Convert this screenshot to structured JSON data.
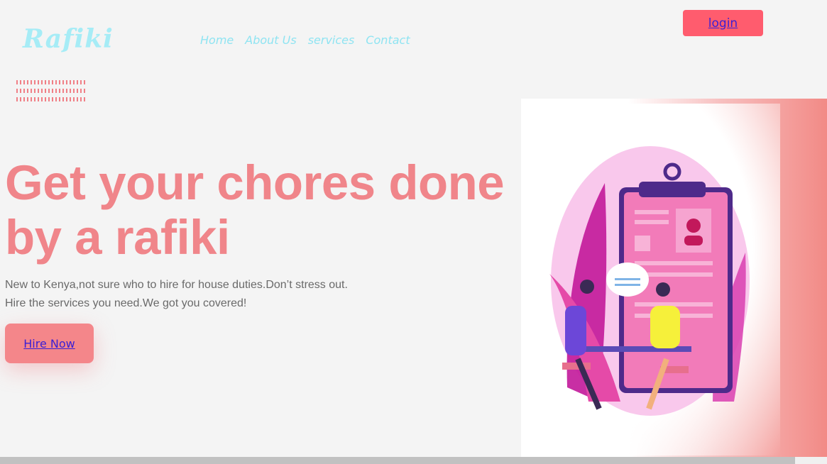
{
  "brand": {
    "logo_text": "Rafiki"
  },
  "nav": {
    "items": [
      {
        "label": "Home"
      },
      {
        "label": "About Us"
      },
      {
        "label": "services"
      },
      {
        "label": "Contact"
      }
    ]
  },
  "header": {
    "login_label": "login"
  },
  "hero": {
    "headline_line1": "Get your chores done",
    "headline_line2": "by a rafiki",
    "sub_line1": "New to Kenya,not sure who to hire for house duties.Don’t stress out.",
    "sub_line2": "Hire the services you need.We got you covered!",
    "cta_label": "Hire Now",
    "illustration": "job-interview-illustration"
  },
  "colors": {
    "accent_pink": "#f0858a",
    "login_bg": "#ff5c6e",
    "logo": "#a6ecf6",
    "nav_link": "#8fe4f2",
    "link_text": "#3a1fd4"
  }
}
